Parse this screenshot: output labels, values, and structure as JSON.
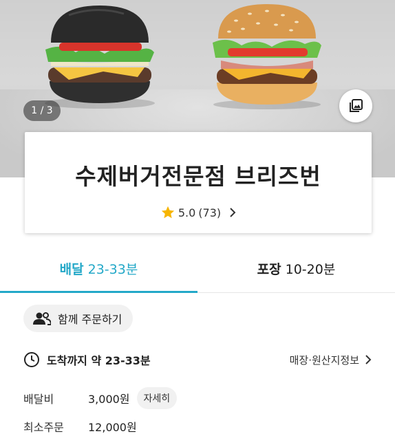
{
  "hero": {
    "page_counter": "1 / 3",
    "gallery_icon": "photo-gallery-icon"
  },
  "store": {
    "name": "수제버거전문점 브리즈번",
    "rating": "5.0",
    "review_count": "(73)",
    "star_color": "#f7b500"
  },
  "tabs": [
    {
      "title": "배달",
      "time": "23-33분",
      "active": true
    },
    {
      "title": "포장",
      "time": "10-20분",
      "active": false
    }
  ],
  "accent_color": "#23a8c8",
  "group_order": {
    "label": "함께 주문하기",
    "icon": "people-icon"
  },
  "arrival": {
    "text": "도착까지 약 23-33분",
    "icon": "clock-icon",
    "info_link": "매장·원산지정보"
  },
  "fees": {
    "delivery_label": "배달비",
    "delivery_value": "3,000원",
    "detail_button": "자세히",
    "min_order_label": "최소주문",
    "min_order_value": "12,000원"
  }
}
